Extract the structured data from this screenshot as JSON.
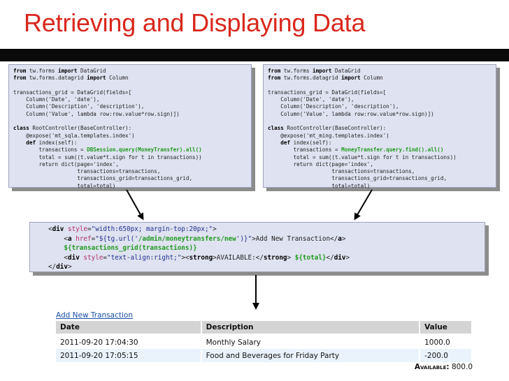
{
  "slide": {
    "title": "Retrieving and Displaying Data"
  },
  "code_left": [
    [
      {
        "t": "from",
        "c": "kw"
      },
      {
        "t": " tw.forms "
      },
      {
        "t": "import",
        "c": "kw"
      },
      {
        "t": " DataGrid"
      }
    ],
    [
      {
        "t": "from",
        "c": "kw"
      },
      {
        "t": " tw.forms.datagrid "
      },
      {
        "t": "import",
        "c": "kw"
      },
      {
        "t": " Column"
      }
    ],
    [],
    [
      {
        "t": "transactions_grid = DataGrid(fields=["
      }
    ],
    [
      {
        "t": "    Column('Date', 'date'),"
      }
    ],
    [
      {
        "t": "    Column('Description', 'description'),"
      }
    ],
    [
      {
        "t": "    Column('Value', lambda row:row.value*row.sign)])"
      }
    ],
    [],
    [
      {
        "t": "class",
        "c": "kw"
      },
      {
        "t": " RootController(BaseController):"
      }
    ],
    [
      {
        "t": "    @expose('mt_sqla.templates.index')"
      }
    ],
    [
      {
        "t": "    "
      },
      {
        "t": "def",
        "c": "kw"
      },
      {
        "t": " index(self):"
      }
    ],
    [
      {
        "t": "        transactions = "
      },
      {
        "t": "DBSession.query(MoneyTransfer).all()",
        "c": "hl"
      }
    ],
    [
      {
        "t": "        total = sum((t.value*t.sign for t in transactions))"
      }
    ],
    [
      {
        "t": "        return dict(page='index',"
      }
    ],
    [
      {
        "t": "                    transactions=transactions,"
      }
    ],
    [
      {
        "t": "                    transactions_grid=transactions_grid,"
      }
    ],
    [
      {
        "t": "                    total=total)"
      }
    ]
  ],
  "code_right": [
    [
      {
        "t": "from",
        "c": "kw"
      },
      {
        "t": " tw.forms "
      },
      {
        "t": "import",
        "c": "kw"
      },
      {
        "t": " DataGrid"
      }
    ],
    [
      {
        "t": "from",
        "c": "kw"
      },
      {
        "t": " tw.forms.datagrid "
      },
      {
        "t": "import",
        "c": "kw"
      },
      {
        "t": " Column"
      }
    ],
    [],
    [
      {
        "t": "transactions_grid = DataGrid(fields=["
      }
    ],
    [
      {
        "t": "    Column('Date', 'date'),"
      }
    ],
    [
      {
        "t": "    Column('Description', 'description'),"
      }
    ],
    [
      {
        "t": "    Column('Value', lambda row:row.value*row.sign)])"
      }
    ],
    [],
    [
      {
        "t": "class",
        "c": "kw"
      },
      {
        "t": " RootController(BaseController):"
      }
    ],
    [
      {
        "t": "    @expose('mt_ming.templates.index')"
      }
    ],
    [
      {
        "t": "    "
      },
      {
        "t": "def",
        "c": "kw"
      },
      {
        "t": " index(self):"
      }
    ],
    [
      {
        "t": "        transactions = "
      },
      {
        "t": "MoneyTransfer.query.find().all()",
        "c": "hl"
      }
    ],
    [
      {
        "t": "        total = sum((t.value*t.sign for t in transactions))"
      }
    ],
    [
      {
        "t": "        return dict(page='index',"
      }
    ],
    [
      {
        "t": "                    transactions=transactions,"
      }
    ],
    [
      {
        "t": "                    transactions_grid=transactions_grid,"
      }
    ],
    [
      {
        "t": "                    total=total)"
      }
    ]
  ],
  "template_code": [
    [
      {
        "t": "<"
      },
      {
        "t": "div",
        "c": "tag"
      },
      {
        "t": " "
      },
      {
        "t": "style",
        "c": "attr"
      },
      {
        "t": "="
      },
      {
        "t": "\"width:650px; margin-top:20px;\"",
        "c": "str"
      },
      {
        "t": ">"
      }
    ],
    [
      {
        "t": "    <"
      },
      {
        "t": "a",
        "c": "tag"
      },
      {
        "t": " "
      },
      {
        "t": "href",
        "c": "attr"
      },
      {
        "t": "="
      },
      {
        "t": "\"${tg.url('",
        "c": "str"
      },
      {
        "t": "/admin/moneytransfers/new",
        "c": "path"
      },
      {
        "t": "')}\"",
        "c": "str"
      },
      {
        "t": ">Add New Transaction</"
      },
      {
        "t": "a",
        "c": "tag"
      },
      {
        "t": ">"
      }
    ],
    [
      {
        "t": "    "
      },
      {
        "t": "${transactions_grid(transactions)}",
        "c": "tplx"
      }
    ],
    [
      {
        "t": "    <"
      },
      {
        "t": "div",
        "c": "tag"
      },
      {
        "t": " "
      },
      {
        "t": "style",
        "c": "attr"
      },
      {
        "t": "="
      },
      {
        "t": "\"text-align:right;\"",
        "c": "str"
      },
      {
        "t": "><"
      },
      {
        "t": "strong",
        "c": "tag"
      },
      {
        "t": ">AVAILABLE:</"
      },
      {
        "t": "strong",
        "c": "tag"
      },
      {
        "t": "> "
      },
      {
        "t": "${total}",
        "c": "tplx"
      },
      {
        "t": "</"
      },
      {
        "t": "div",
        "c": "tag"
      },
      {
        "t": ">"
      }
    ],
    [
      {
        "t": "</"
      },
      {
        "t": "div",
        "c": "tag"
      },
      {
        "t": ">"
      }
    ]
  ],
  "datagrid": {
    "link": "Add New Transaction",
    "columns": [
      "Date",
      "Description",
      "Value"
    ],
    "rows": [
      [
        "2011-09-20 17:04:30",
        "Monthly Salary",
        "1000.0"
      ],
      [
        "2011-09-20 17:05:15",
        "Food and Beverages for Friday Party",
        "-200.0"
      ]
    ],
    "available_label": "Available:",
    "available_value": "800.0"
  },
  "colors": {
    "title": "#d9271c",
    "box_bg": "#dfe2f0",
    "highlight": "#1e9a1e",
    "row_alt": "#eaf3fc",
    "header_bg": "#d4d4d4"
  }
}
